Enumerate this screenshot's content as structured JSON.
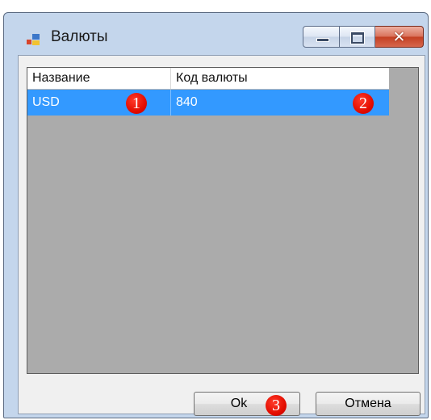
{
  "window": {
    "title": "Валюты",
    "controls": {
      "minimize": "minimize",
      "maximize": "maximize",
      "close": "close"
    },
    "close_glyph": "✕"
  },
  "grid": {
    "columns": [
      "Название",
      "Код валюты"
    ],
    "rows": [
      {
        "name": "USD",
        "code": "840",
        "selected": true
      }
    ],
    "selection_color": "#3399ff",
    "background_color": "#ababab"
  },
  "markers": [
    "1",
    "2",
    "3"
  ],
  "buttons": {
    "ok": "Ok",
    "cancel": "Отмена"
  }
}
